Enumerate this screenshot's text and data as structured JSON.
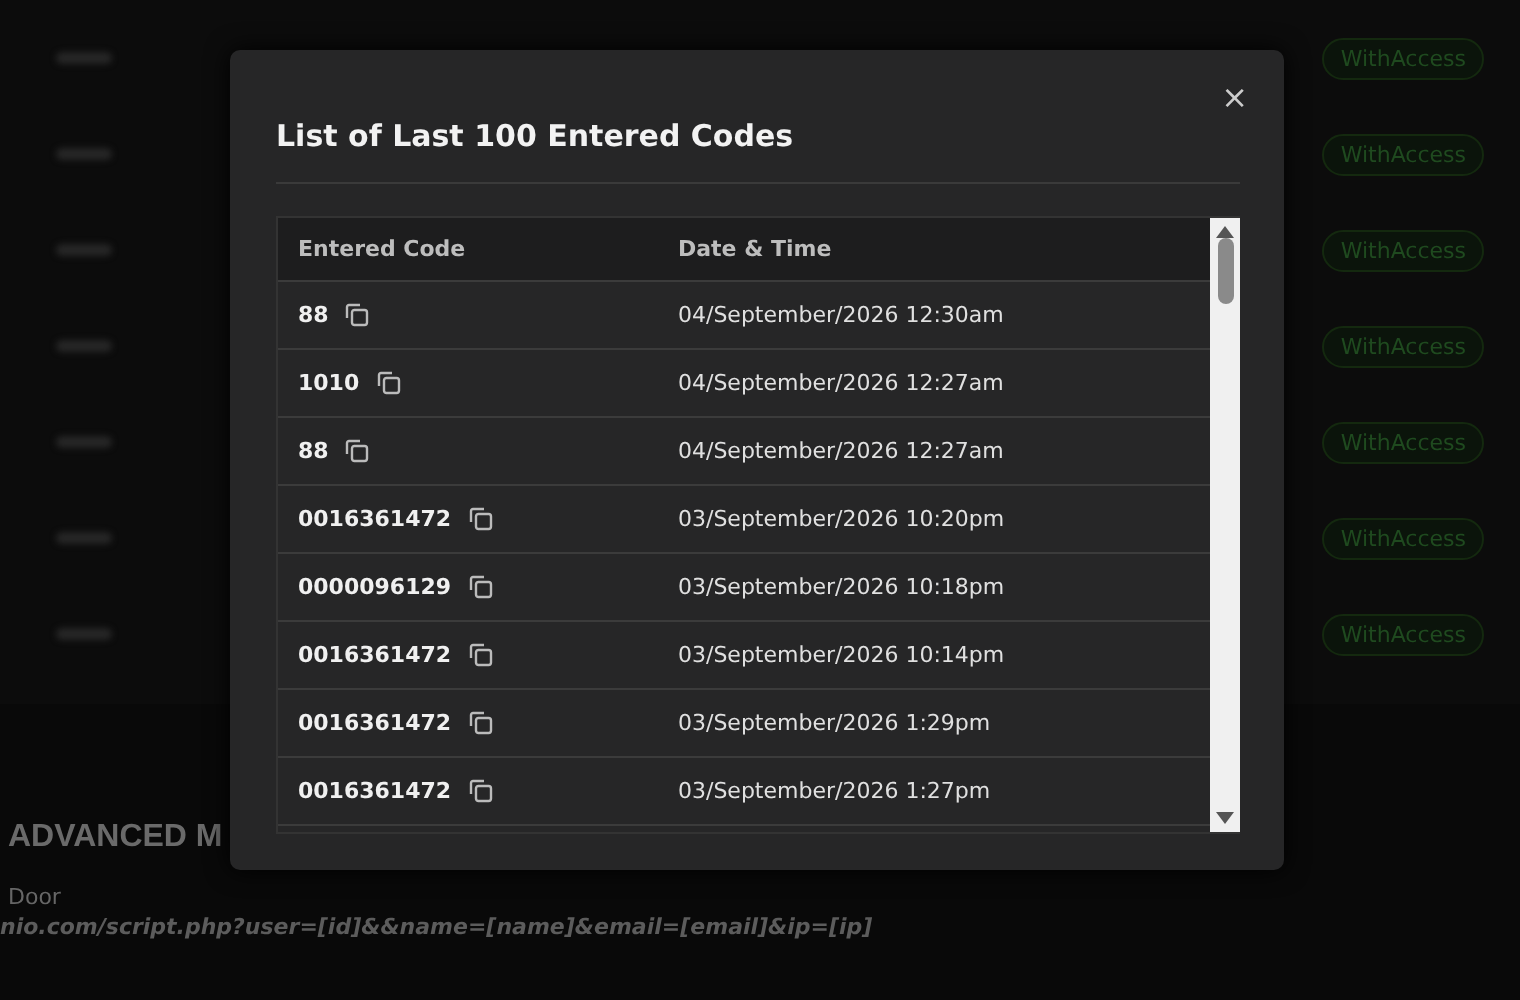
{
  "background": {
    "badges": [
      "WithAccess",
      "WithAccess",
      "WithAccess",
      "WithAccess",
      "WithAccess",
      "WithAccess",
      "WithAccess"
    ],
    "section_title": "ADVANCED M",
    "field_label": "Door",
    "url": "nio.com/script.php?user=[id]&&name=[name]&email=[email]&ip=[ip]"
  },
  "modal": {
    "title": "List of Last 100 Entered Codes",
    "close": "×",
    "table": {
      "columns": [
        "Entered Code",
        "Date & Time"
      ],
      "rows": [
        {
          "code": "88",
          "time": "04/September/2026 12:30am"
        },
        {
          "code": "1010",
          "time": "04/September/2026 12:27am"
        },
        {
          "code": "88",
          "time": "04/September/2026 12:27am"
        },
        {
          "code": "0016361472",
          "time": "03/September/2026 10:20pm"
        },
        {
          "code": "0000096129",
          "time": "03/September/2026 10:18pm"
        },
        {
          "code": "0016361472",
          "time": "03/September/2026 10:14pm"
        },
        {
          "code": "0016361472",
          "time": "03/September/2026 1:29pm"
        },
        {
          "code": "0016361472",
          "time": "03/September/2026 1:27pm"
        }
      ]
    }
  }
}
